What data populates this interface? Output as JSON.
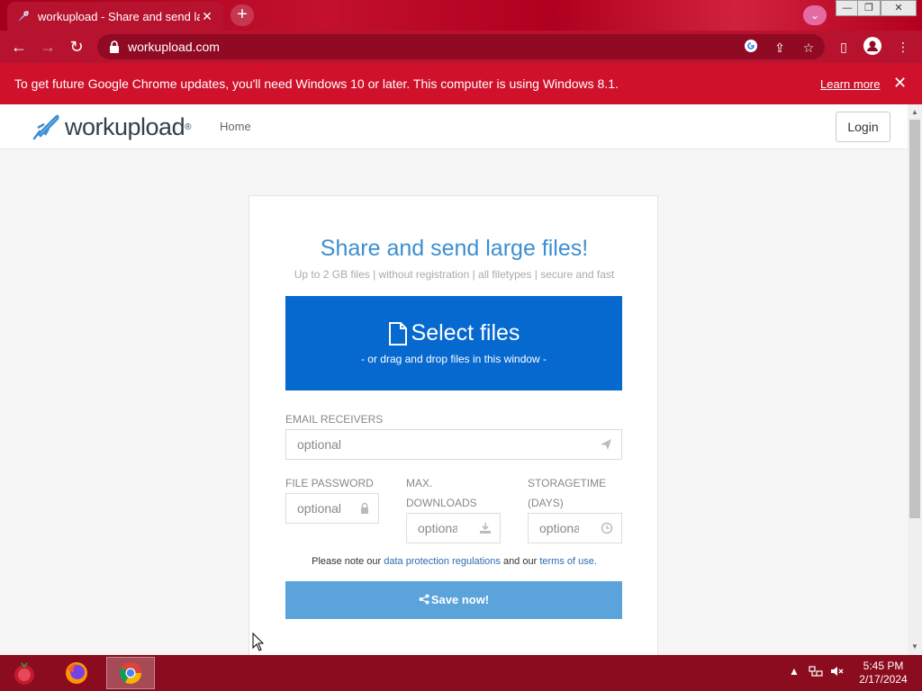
{
  "browser": {
    "tab_title": "workupload - Share and send large files",
    "tab_close": "✕",
    "new_tab": "+",
    "url": "workupload.com",
    "window_controls": [
      "—",
      "❐",
      "✕"
    ]
  },
  "infobar": {
    "message": "To get future Google Chrome updates, you'll need Windows 10 or later. This computer is using Windows 8.1.",
    "learn_more": "Learn more",
    "close": "✕"
  },
  "site": {
    "logo_text": "workupload",
    "logo_reg": "®",
    "nav_home": "Home",
    "login": "Login"
  },
  "upload": {
    "title": "Share and send large files!",
    "subtitle": "Up to 2 GB files | without registration | all filetypes | secure and fast",
    "select_label": "Select files",
    "select_sub": "- or drag and drop files in this window -",
    "email_label": "EMAIL RECEIVERS",
    "email_placeholder": "optional",
    "password_label": "FILE PASSWORD",
    "password_placeholder": "optional",
    "downloads_label_1": "MAX.",
    "downloads_label_2": "DOWNLOADS",
    "downloads_placeholder": "optional",
    "storage_label_1": "STORAGETIME",
    "storage_label_2": "(DAYS)",
    "storage_placeholder": "optional",
    "note_pre": "Please note our ",
    "note_link1": "data protection regulations",
    "note_mid": " and our ",
    "note_link2": "terms of use.",
    "save_label": "Save now!"
  },
  "taskbar": {
    "time": "5:45 PM",
    "date": "2/17/2024"
  },
  "colors": {
    "chrome_red": "#b7132f",
    "infobar_red": "#d0112b",
    "select_blue": "#0669cf",
    "save_blue": "#5ba3db",
    "title_blue": "#3c8fd2"
  }
}
